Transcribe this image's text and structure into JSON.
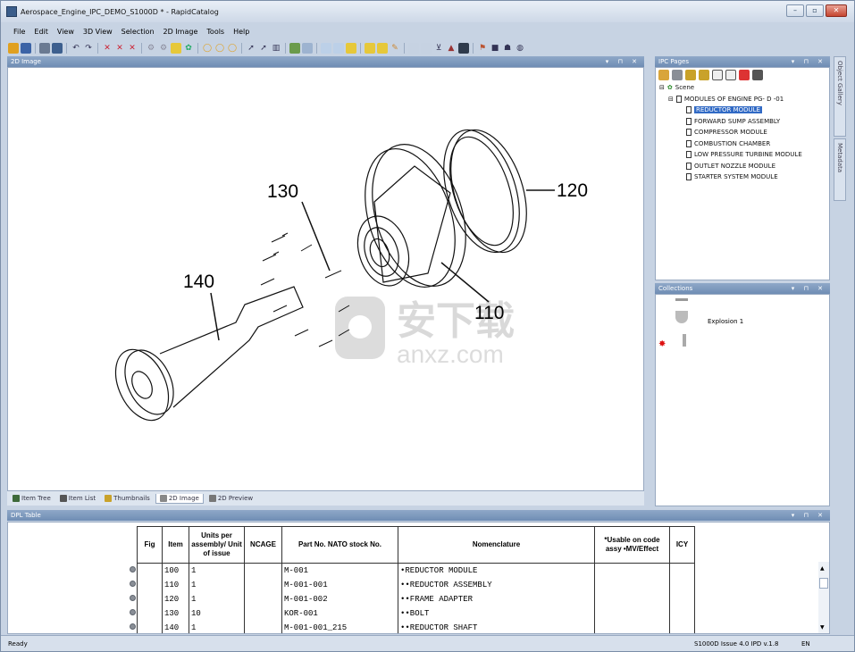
{
  "window": {
    "title": "Aerospace_Engine_IPC_DEMO_S1000D * - RapidCatalog",
    "min": "–",
    "max": "▫",
    "close": "✕"
  },
  "menu": [
    "File",
    "Edit",
    "View",
    "3D View",
    "Selection",
    "2D Image",
    "Tools",
    "Help"
  ],
  "panels": {
    "image_title": "2D Image",
    "ipc_title": "IPC Pages",
    "collections_title": "Collections",
    "dpl_title": "DPL Table",
    "controls": "▾ ⊓ ✕"
  },
  "side_tabs": [
    "Object Gallery",
    "Metadata"
  ],
  "drawing": {
    "callouts": [
      "130",
      "120",
      "140",
      "110"
    ],
    "watermark_cn": "安下载",
    "watermark_en": "anxz.com"
  },
  "image_tabs": [
    {
      "label": "Item Tree",
      "active": false
    },
    {
      "label": "Item List",
      "active": false
    },
    {
      "label": "Thumbnails",
      "active": false
    },
    {
      "label": "2D Image",
      "active": true
    },
    {
      "label": "2D Preview",
      "active": false
    }
  ],
  "tree": {
    "scene": "Scene",
    "root": "MODULES OF ENGINE PG- D -01",
    "children": [
      "REDUCTOR MODULE",
      "FORWARD SUMP ASSEMBLY",
      "COMPRESSOR MODULE",
      "COMBUSTION CHAMBER",
      "LOW PRESSURE TURBINE MODULE",
      "OUTLET NOZZLE MODULE",
      "STARTER SYSTEM MODULE"
    ],
    "selected_index": 0
  },
  "collections": {
    "item": "Explosion 1"
  },
  "dpl": {
    "headers": [
      "Fig",
      "Item",
      "Units per assembly/ Unit of issue",
      "NCAGE",
      "Part No. NATO stock No.",
      "Nomenclature",
      "*Usable on code assy •MV/Effect",
      "ICY"
    ],
    "rows": [
      {
        "fig": "",
        "item": "100",
        "units": "1",
        "ncage": "",
        "part": "M-001",
        "nom": "•REDUCTOR MODULE",
        "usable": "",
        "icy": ""
      },
      {
        "fig": "",
        "item": "110",
        "units": "1",
        "ncage": "",
        "part": "M-001-001",
        "nom": "••REDUCTOR ASSEMBLY",
        "usable": "",
        "icy": ""
      },
      {
        "fig": "",
        "item": "120",
        "units": "1",
        "ncage": "",
        "part": "M-001-002",
        "nom": "••FRAME ADAPTER",
        "usable": "",
        "icy": ""
      },
      {
        "fig": "",
        "item": "130",
        "units": "10",
        "ncage": "",
        "part": "KOR-001",
        "nom": "••BOLT",
        "usable": "",
        "icy": ""
      },
      {
        "fig": "",
        "item": "140",
        "units": "1",
        "ncage": "",
        "part": "M-001-001_215",
        "nom": "••REDUCTOR SHAFT",
        "usable": "",
        "icy": ""
      }
    ]
  },
  "status": {
    "left": "Ready",
    "version": "S1000D Issue 4.0 IPD v.1.8",
    "lang": "EN"
  }
}
